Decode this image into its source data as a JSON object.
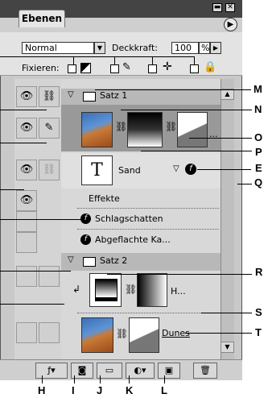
{
  "panel": {
    "tab_label": "Ebenen",
    "menu_icon": "triangle-right-icon",
    "minimize_label": "▬",
    "close_label": "✕"
  },
  "options": {
    "blend_mode": "Normal",
    "opacity_label": "Deckkraft:",
    "opacity_value": "100",
    "opacity_unit": "%",
    "lock_label": "Fixieren:"
  },
  "layers": {
    "set1_name": "Satz 1",
    "text_layer_name": "Sand",
    "effects_label": "Effekte",
    "effect1": "Schlagschatten",
    "effect2": "Abgeflachte Ka...",
    "set2_name": "Satz 2",
    "adjustment_name": "H...",
    "dunes_name": "Dunes",
    "ellipsis": "..."
  },
  "callouts": {
    "right": [
      "M",
      "N",
      "O",
      "P",
      "E",
      "Q",
      "R",
      "S",
      "T"
    ],
    "bottom": [
      "H",
      "I",
      "J",
      "K",
      "L"
    ]
  },
  "colors": {
    "panel_bg": "#c9c9c9",
    "titlebar": "#444444",
    "set_row": "#b8b8b8"
  }
}
